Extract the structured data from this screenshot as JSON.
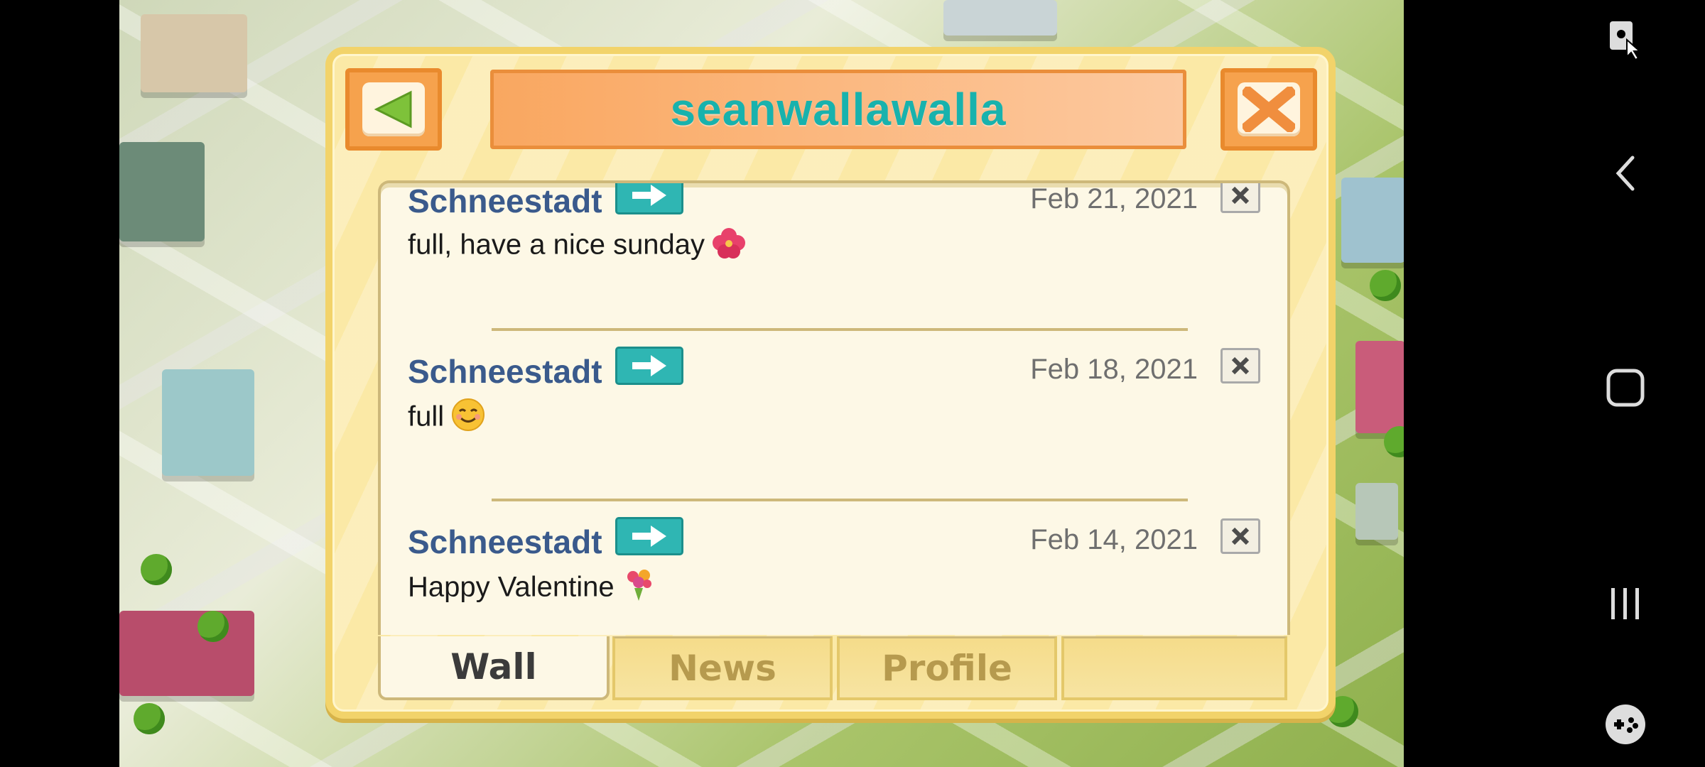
{
  "dialog": {
    "title": "seanwallawalla"
  },
  "posts": [
    {
      "author": "Schneestadt",
      "date": "Feb 21, 2021",
      "text": "full, have a nice sunday",
      "emoji": "hibiscus"
    },
    {
      "author": "Schneestadt",
      "date": "Feb 18, 2021",
      "text": "full",
      "emoji": "smiling-face"
    },
    {
      "author": "Schneestadt",
      "date": "Feb 14, 2021",
      "text": "Happy Valentine",
      "emoji": "bouquet"
    }
  ],
  "tabs": [
    {
      "label": "Wall",
      "active": true
    },
    {
      "label": "News",
      "active": false
    },
    {
      "label": "Profile",
      "active": false
    },
    {
      "label": "",
      "active": false
    }
  ],
  "colors": {
    "title_text": "#18b2ad",
    "author_text": "#3a5a8c",
    "dialog_bg": "#fbe9a6",
    "arrow_button": "#2fb6b3"
  },
  "icons": {
    "back": "triangle-left-icon",
    "close": "x-close-icon",
    "post_arrow": "arrow-right-icon",
    "post_delete": "x-delete-icon"
  },
  "system_nav": [
    "screen-lock-icon",
    "back-icon",
    "home-icon",
    "recents-icon",
    "game-tools-icon"
  ]
}
